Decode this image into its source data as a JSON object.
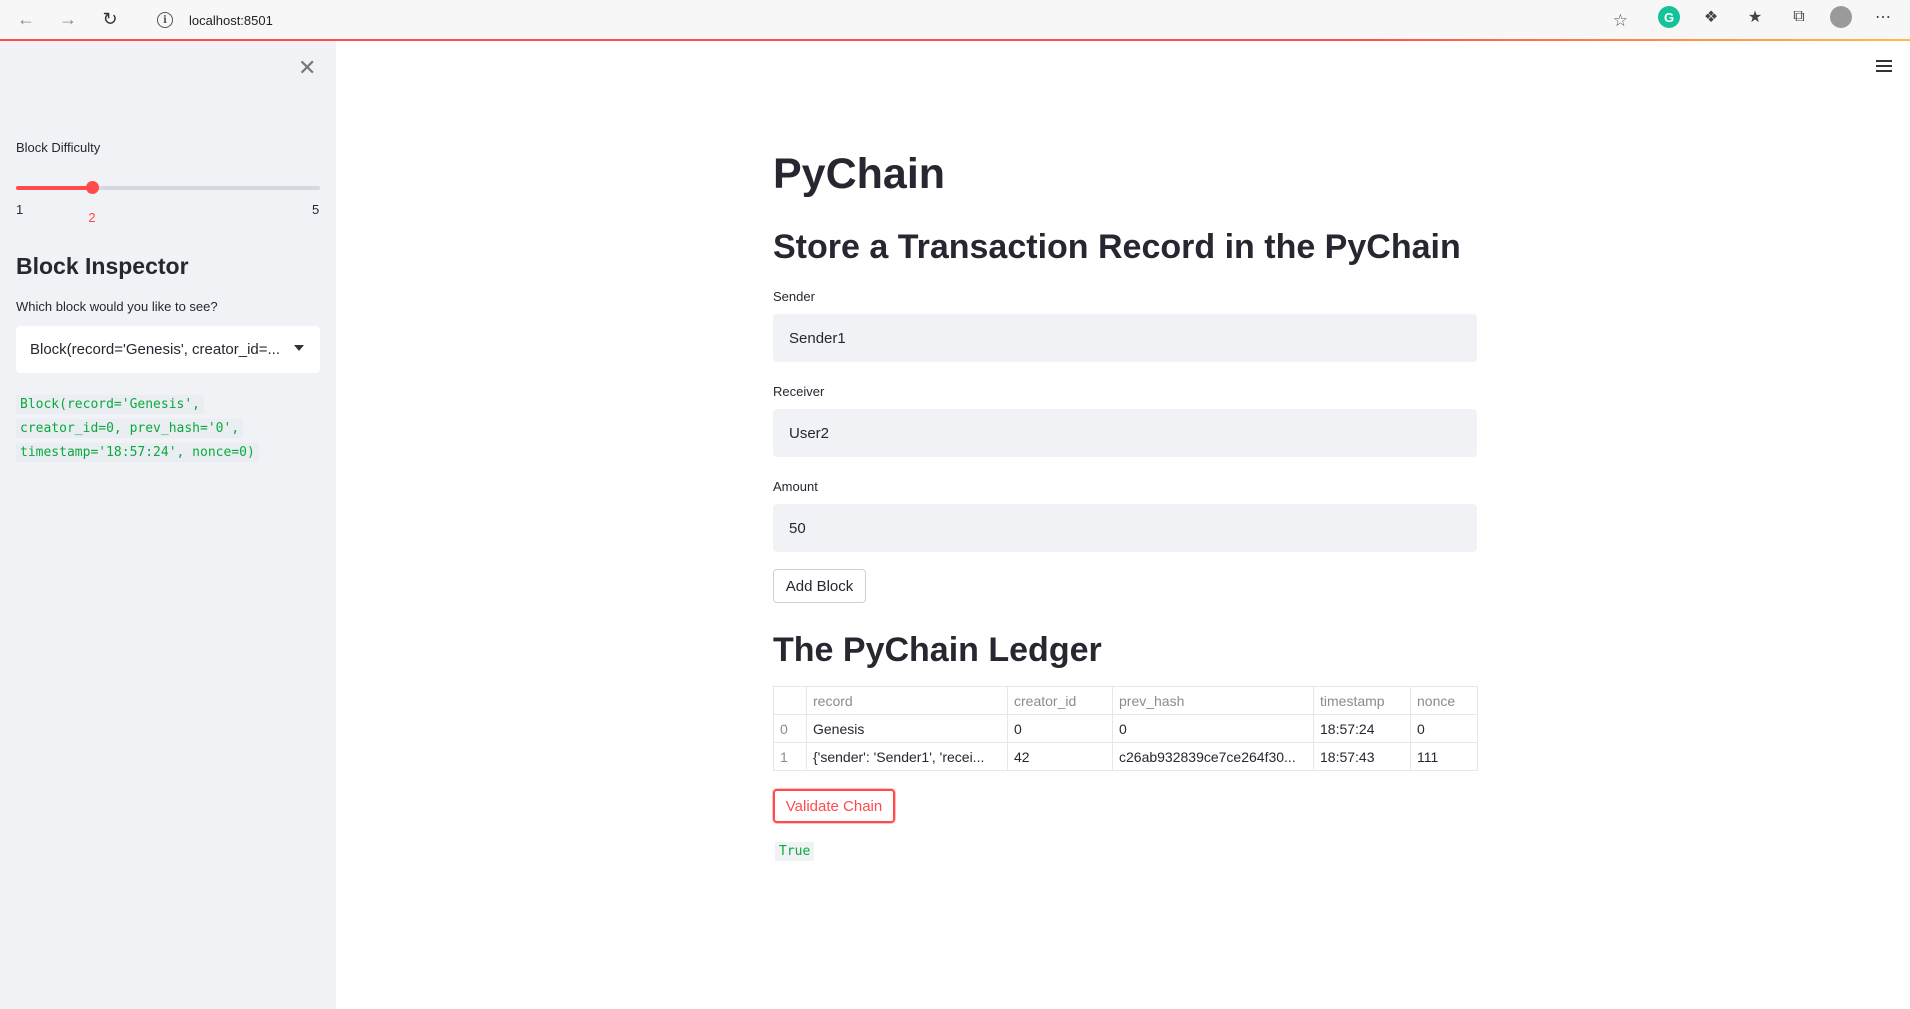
{
  "browser": {
    "url": "localhost:8501"
  },
  "sidebar": {
    "slider": {
      "label": "Block Difficulty",
      "value": 2,
      "value_text": "2",
      "min": 1,
      "max": 5,
      "min_text": "1",
      "max_text": "5"
    },
    "inspector_heading": "Block Inspector",
    "inspector_question": "Which block would you like to see?",
    "select_value": "Block(record='Genesis', creator_id=...",
    "code_lines": [
      "Block(record='Genesis',",
      "creator_id=0, prev_hash='0',",
      "timestamp='18:57:24', nonce=0)"
    ]
  },
  "main": {
    "title": "PyChain",
    "subtitle": "Store a Transaction Record in the PyChain",
    "fields": {
      "sender_label": "Sender",
      "sender_value": "Sender1",
      "receiver_label": "Receiver",
      "receiver_value": "User2",
      "amount_label": "Amount",
      "amount_value": "50"
    },
    "add_block_label": "Add Block",
    "ledger_title": "The PyChain Ledger",
    "ledger": {
      "columns": [
        "",
        "record",
        "creator_id",
        "prev_hash",
        "timestamp",
        "nonce"
      ],
      "rows": [
        [
          "0",
          "Genesis",
          "0",
          "0",
          "18:57:24",
          "0"
        ],
        [
          "1",
          "{'sender': 'Sender1', 'recei...",
          "42",
          "c26ab932839ce7ce264f30...",
          "18:57:43",
          "111"
        ]
      ]
    },
    "validate_label": "Validate Chain",
    "validate_result": "True"
  },
  "colors": {
    "accent": "#ff4b4b",
    "code_green": "#09ab3b",
    "sidebar_bg": "#f0f2f6"
  }
}
